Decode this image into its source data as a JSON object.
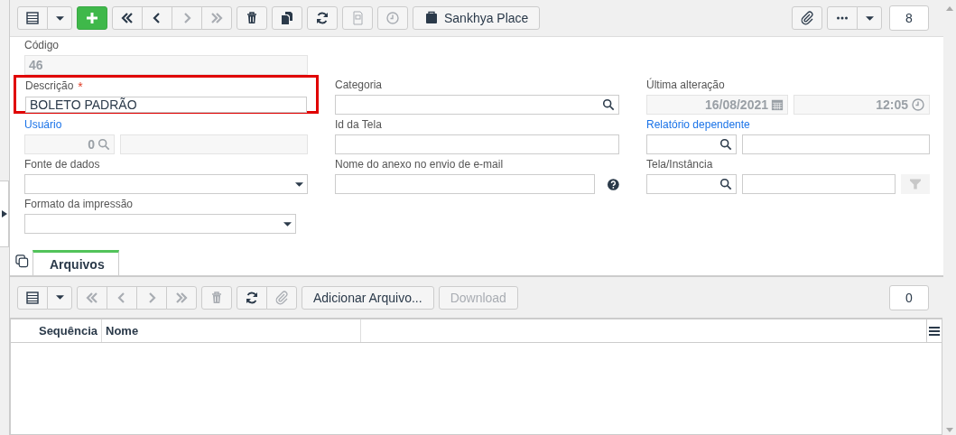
{
  "toolbar": {
    "groups": [
      [
        {
          "kind": "grid",
          "disabled": false
        },
        {
          "kind": "caret",
          "disabled": false
        }
      ],
      [
        {
          "kind": "add",
          "disabled": false
        }
      ],
      [
        {
          "kind": "first",
          "disabled": false
        },
        {
          "kind": "prev",
          "disabled": false
        },
        {
          "kind": "next",
          "disabled": true
        },
        {
          "kind": "last",
          "disabled": true
        }
      ],
      [
        {
          "kind": "delete",
          "disabled": false
        }
      ],
      [
        {
          "kind": "copy",
          "disabled": false
        }
      ],
      [
        {
          "kind": "refresh",
          "disabled": false
        }
      ],
      [
        {
          "kind": "report",
          "disabled": true
        }
      ],
      [
        {
          "kind": "clock",
          "disabled": true
        }
      ],
      [
        {
          "kind": "briefcase",
          "label": "Sankhya Place",
          "disabled": false
        }
      ]
    ],
    "right_groups": [
      [
        {
          "kind": "clip",
          "disabled": false
        }
      ],
      [
        {
          "kind": "more",
          "disabled": false
        },
        {
          "kind": "caret",
          "disabled": false
        }
      ]
    ],
    "count": "8"
  },
  "form": {
    "rows": [
      {
        "fields": [
          {
            "kind": "text",
            "label": "Código",
            "value": "46",
            "disabled": true,
            "link": false,
            "highlighted": false
          }
        ]
      },
      {
        "fields": [
          {
            "kind": "text",
            "label": "Descrição",
            "value": "BOLETO PADRÃO",
            "disabled": false,
            "required_mark": "*",
            "link": false,
            "highlighted": true
          },
          {
            "kind": "search",
            "label": "Categoria",
            "link": false
          },
          {
            "kind": "datetime",
            "label": "Última alteração",
            "date": "16/08/2021",
            "time": "12:05",
            "disabled": true,
            "link": false
          }
        ]
      },
      {
        "fields": [
          {
            "kind": "lookup",
            "label": "Usuário",
            "code": "0",
            "disabled": true,
            "link": true
          },
          {
            "kind": "text",
            "label": "Id da Tela",
            "disabled": false,
            "link": false,
            "highlighted": false
          },
          {
            "kind": "lookup",
            "label": "Relatório dependente",
            "disabled": false,
            "link": true
          }
        ]
      },
      {
        "fields": [
          {
            "kind": "select",
            "label": "Fonte de dados",
            "link": false
          },
          {
            "kind": "help",
            "label": "Nome do anexo no envio de e-mail",
            "link": false
          },
          {
            "kind": "lookup_filter",
            "label": "Tela/Instância",
            "disabled": false,
            "link": false
          }
        ]
      },
      {
        "fields": [
          {
            "kind": "select",
            "label": "Formato da impressão",
            "link": false
          }
        ]
      }
    ]
  },
  "tabs": [
    {
      "label": "Arquivos",
      "selected": true
    }
  ],
  "files_toolbar": {
    "groups": [
      [
        {
          "kind": "grid",
          "disabled": false
        },
        {
          "kind": "caret",
          "disabled": false
        }
      ],
      [
        {
          "kind": "first",
          "disabled": true
        },
        {
          "kind": "prev",
          "disabled": true
        },
        {
          "kind": "next",
          "disabled": true
        },
        {
          "kind": "last",
          "disabled": true
        }
      ],
      [
        {
          "kind": "delete",
          "disabled": true
        }
      ],
      [
        {
          "kind": "refresh",
          "disabled": false
        },
        {
          "kind": "clip",
          "disabled": true
        }
      ],
      [
        {
          "kind": "text",
          "label": "Adicionar Arquivo...",
          "disabled": false
        }
      ],
      [
        {
          "kind": "text",
          "label": "Download",
          "disabled": true
        }
      ]
    ],
    "count": "0"
  },
  "table": {
    "columns": [
      "Sequência",
      "Nome"
    ]
  }
}
